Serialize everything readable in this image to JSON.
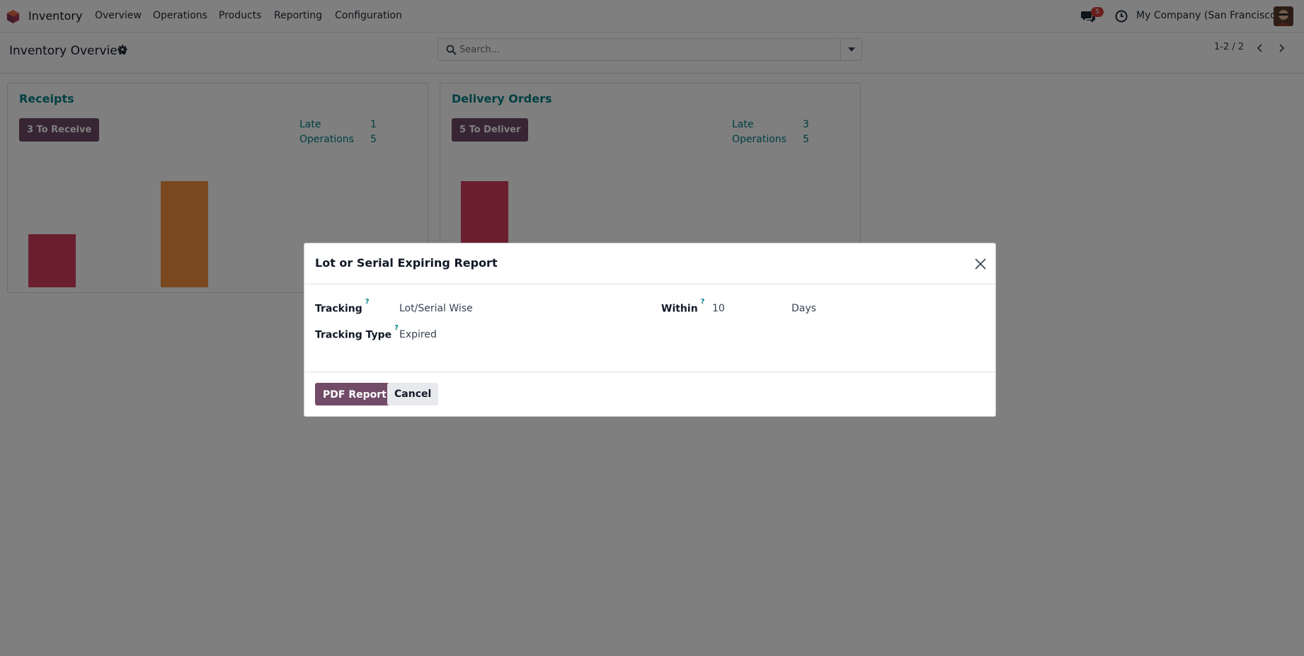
{
  "navbar": {
    "app_name": "Inventory",
    "menu": [
      "Overview",
      "Operations",
      "Products",
      "Reporting",
      "Configuration"
    ],
    "chat_count": "5",
    "company": "My Company (San Francisco)",
    "icons": {
      "app": "odoo-inventory-logo-icon",
      "chat": "chat-bubbles-icon",
      "activity": "clock-icon",
      "user": "user-avatar"
    }
  },
  "control_panel": {
    "title": "Inventory Overview",
    "search_placeholder": "Search...",
    "pager": "1-2 / 2"
  },
  "cards": [
    {
      "title": "Receipts",
      "button": "3 To Receive",
      "stats": [
        {
          "label": "Late",
          "value": "1"
        },
        {
          "label": "Operations",
          "value": "5"
        }
      ],
      "graph_bars": [
        {
          "value": 2,
          "color": "#d23f5a"
        },
        {
          "value": 4,
          "color": "#f39141"
        }
      ]
    },
    {
      "title": "Delivery Orders",
      "button": "5 To Deliver",
      "stats": [
        {
          "label": "Late",
          "value": "3"
        },
        {
          "label": "Operations",
          "value": "5"
        }
      ],
      "graph_bars": [
        {
          "value": 4,
          "color": "#d23f5a"
        }
      ]
    }
  ],
  "modal": {
    "title": "Lot or Serial Expiring Report",
    "fields": {
      "tracking": {
        "label": "Tracking",
        "help": "?",
        "value": "Lot/Serial Wise"
      },
      "tracking_type": {
        "label": "Tracking Type",
        "help": "?",
        "value": "Expired"
      },
      "within": {
        "label": "Within",
        "help": "?",
        "value": "10",
        "unit": "Days"
      }
    },
    "buttons": {
      "primary": "PDF Report",
      "secondary": "Cancel"
    }
  },
  "colors": {
    "brand": "#714b67",
    "accent": "#017e84",
    "late_bar": "#d23f5a",
    "future_bar": "#f39141",
    "badge": "#d23f3a"
  }
}
